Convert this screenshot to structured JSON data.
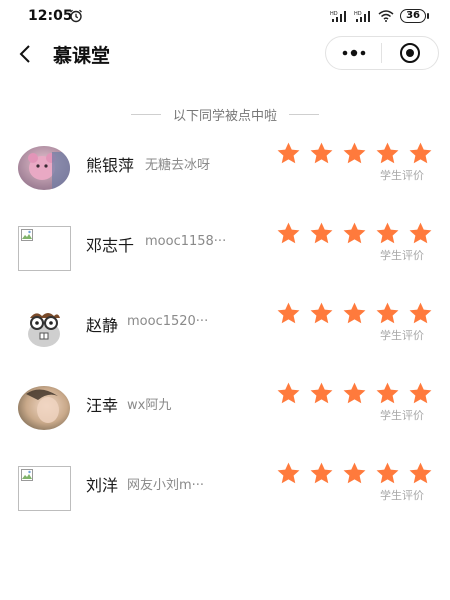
{
  "status_bar": {
    "time": "12:05",
    "battery": "36",
    "icons": [
      "alarm-icon",
      "hd-signal-icon",
      "hd-signal-icon",
      "wifi-icon",
      "battery-icon"
    ]
  },
  "navbar": {
    "title": "慕课堂",
    "icons": [
      "back-arrow-icon",
      "more-dots-icon",
      "close-target-icon"
    ]
  },
  "section_title": "以下同学被点中啦",
  "rating_label": "学生评价",
  "star_color": "#ff7a3c",
  "students": [
    {
      "name": "熊银萍",
      "nickname": "无糖去冰呀",
      "avatar": "pink-bear-avatar",
      "stars": 5
    },
    {
      "name": "邓志千",
      "nickname": "mooc1158···",
      "avatar": "broken-image-avatar",
      "stars": 5
    },
    {
      "name": "赵静",
      "nickname": "mooc1520···",
      "avatar": "cartoon-glasses-avatar",
      "stars": 5
    },
    {
      "name": "汪幸",
      "nickname": "wx阿九",
      "avatar": "photo-avatar",
      "stars": 5
    },
    {
      "name": "刘洋",
      "nickname": "网友小刘m···",
      "avatar": "broken-image-avatar",
      "stars": 5
    }
  ]
}
